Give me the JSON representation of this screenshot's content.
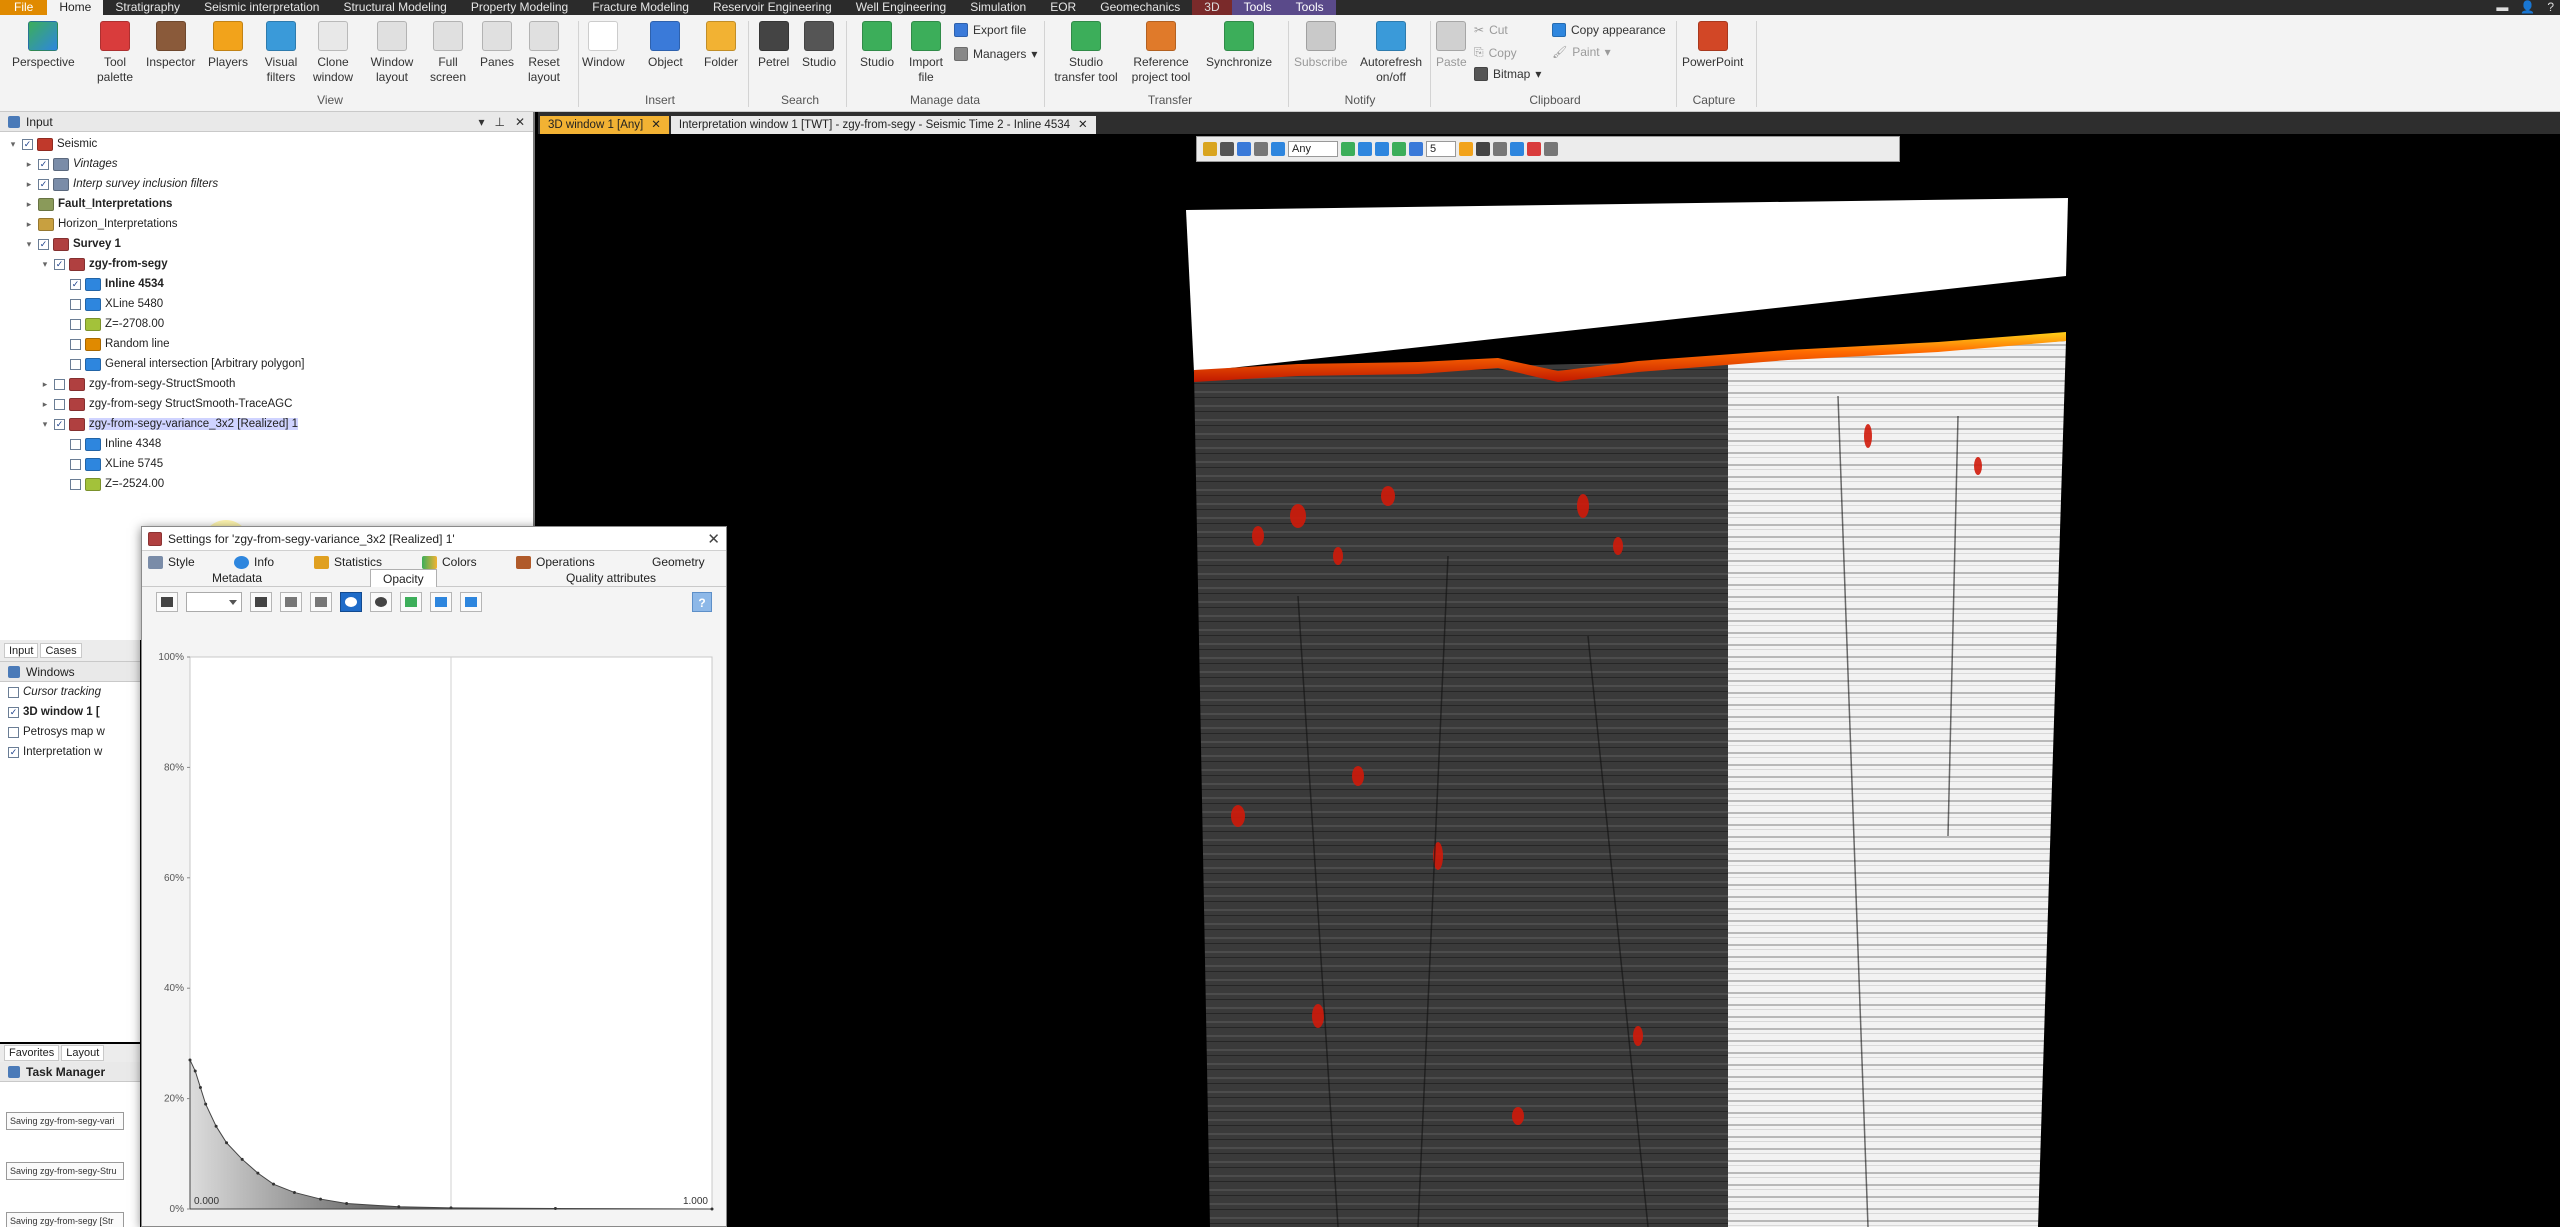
{
  "menu": {
    "tabs": [
      "File",
      "Home",
      "Stratigraphy",
      "Seismic interpretation",
      "Structural Modeling",
      "Property Modeling",
      "Fracture Modeling",
      "Reservoir Engineering",
      "Well Engineering",
      "Simulation",
      "EOR",
      "Geomechanics",
      "3D",
      "Tools",
      "Tools"
    ],
    "active": "Home"
  },
  "ribbon": {
    "buttons": {
      "perspective": "Perspective",
      "tool_palette": "Tool palette",
      "inspector": "Inspector",
      "players": "Players",
      "visual_filters": "Visual filters",
      "clone_window": "Clone window",
      "window_layout": "Window layout",
      "full_screen": "Full screen",
      "panes": "Panes",
      "reset_layout": "Reset layout",
      "window": "Window",
      "object": "Object",
      "folder": "Folder",
      "petrel": "Petrel",
      "studio_search": "Studio",
      "studio_manage": "Studio",
      "import_file": "Import file",
      "export_file": "Export file",
      "managers": "Managers",
      "studio_transfer": "Studio transfer tool",
      "reference_project": "Reference project tool",
      "synchronize": "Synchronize",
      "subscribe": "Subscribe",
      "autorefresh": "Autorefresh on/off",
      "paste": "Paste",
      "cut": "Cut",
      "copy": "Copy",
      "bitmap": "Bitmap",
      "copy_appearance": "Copy appearance",
      "paint": "Paint",
      "powerpoint": "PowerPoint"
    },
    "groups": {
      "view": "View",
      "insert": "Insert",
      "search": "Search",
      "manage_data": "Manage data",
      "transfer": "Transfer",
      "notify": "Notify",
      "clipboard": "Clipboard",
      "capture": "Capture"
    }
  },
  "input_pane": {
    "title": "Input",
    "tree": [
      {
        "label": "Seismic",
        "level": 0,
        "checked": true,
        "icon_color": "#c0392b"
      },
      {
        "label": "Vintages",
        "level": 1,
        "checked": true,
        "icon_color": "#7a8ca8",
        "italic": true
      },
      {
        "label": "Interp survey inclusion filters",
        "level": 1,
        "checked": true,
        "icon_color": "#7a8ca8",
        "italic": true
      },
      {
        "label": "Fault_Interpretations",
        "level": 1,
        "checked": null,
        "icon_color": "#8a9a5a",
        "bold": true
      },
      {
        "label": "Horizon_Interpretations",
        "level": 1,
        "checked": null,
        "icon_color": "#c8a040"
      },
      {
        "label": "Survey 1",
        "level": 1,
        "checked": true,
        "icon_color": "#b04040",
        "bold": true
      },
      {
        "label": "zgy-from-segy",
        "level": 2,
        "checked": true,
        "icon_color": "#b04040",
        "bold": true
      },
      {
        "label": "Inline 4534",
        "level": 3,
        "checked": true,
        "icon_color": "#2e86de",
        "bold": true
      },
      {
        "label": "XLine 5480",
        "level": 3,
        "checked": false,
        "icon_color": "#2e86de"
      },
      {
        "label": "Z=-2708.00",
        "level": 3,
        "checked": false,
        "icon_color": "#a3c23a"
      },
      {
        "label": "Random line",
        "level": 3,
        "checked": false,
        "icon_color": "#e08a00"
      },
      {
        "label": "General intersection [Arbitrary polygon]",
        "level": 3,
        "checked": false,
        "icon_color": "#2e86de"
      },
      {
        "label": "zgy-from-segy-StructSmooth",
        "level": 2,
        "checked": false,
        "icon_color": "#b04040"
      },
      {
        "label": "zgy-from-segy StructSmooth-TraceAGC",
        "level": 2,
        "checked": false,
        "icon_color": "#b04040"
      },
      {
        "label": "zgy-from-segy-variance_3x2 [Realized] 1",
        "level": 2,
        "checked": true,
        "icon_color": "#b04040",
        "selected": true
      },
      {
        "label": "Inline 4348",
        "level": 3,
        "checked": false,
        "icon_color": "#2e86de"
      },
      {
        "label": "XLine 5745",
        "level": 3,
        "checked": false,
        "icon_color": "#2e86de"
      },
      {
        "label": "Z=-2524.00",
        "level": 3,
        "checked": false,
        "icon_color": "#a3c23a"
      }
    ]
  },
  "lower_left": {
    "tabs": [
      "Input",
      "Cases"
    ],
    "windows_title": "Windows",
    "windows": [
      {
        "label": "Cursor tracking",
        "italic": true
      },
      {
        "label": "3D window 1 [",
        "bold": true,
        "checked": true
      },
      {
        "label": "Petrosys map w",
        "checked": false
      },
      {
        "label": "Interpretation w",
        "checked": true
      }
    ],
    "task_tabs": [
      "Favorites",
      "Layout"
    ],
    "task_manager_title": "Task Manager",
    "tasks": [
      "Saving zgy-from-segy-vari",
      "Saving zgy-from-segy-Stru",
      "Saving zgy-from-segy [Str"
    ]
  },
  "doc_tabs": [
    {
      "label": "3D window 1 [Any]",
      "active": true
    },
    {
      "label": "Interpretation window 1 [TWT] - zgy-from-segy - Seismic Time 2 - Inline 4534",
      "active": false
    }
  ],
  "toolbar3d": {
    "select_value": "Any",
    "field_value": "5"
  },
  "dialog": {
    "title": "Settings for 'zgy-from-segy-variance_3x2 [Realized] 1'",
    "tabs_row1": [
      "Style",
      "Info",
      "Statistics",
      "Colors",
      "Operations",
      "Geometry"
    ],
    "tabs_row2": [
      "Metadata",
      "Opacity",
      "Quality attributes"
    ],
    "active_tab": "Opacity",
    "help": "?"
  },
  "chart_data": {
    "type": "area",
    "title": "",
    "xlabel": "",
    "ylabel": "",
    "x_tick_labels": [
      "0.000",
      "1.000"
    ],
    "y_tick_labels": [
      "0%",
      "20%",
      "40%",
      "60%",
      "80%",
      "100%"
    ],
    "xlim": [
      0,
      1
    ],
    "ylim": [
      0,
      100
    ],
    "series": [
      {
        "x": [
          0.0,
          0.01,
          0.02,
          0.03,
          0.05,
          0.07,
          0.1,
          0.13,
          0.16,
          0.2,
          0.25,
          0.3,
          0.4,
          0.5,
          0.7,
          1.0
        ],
        "y": [
          27,
          25,
          22,
          19,
          15,
          12,
          9,
          6.5,
          4.5,
          3,
          1.8,
          1,
          0.4,
          0.2,
          0.1,
          0
        ]
      }
    ],
    "grid": false,
    "vertical_gridline_at": 0.5
  },
  "colors": {
    "accent": "#f2b233",
    "selection": "#cfd3ff",
    "seismic_hot": "#ff3a00"
  }
}
